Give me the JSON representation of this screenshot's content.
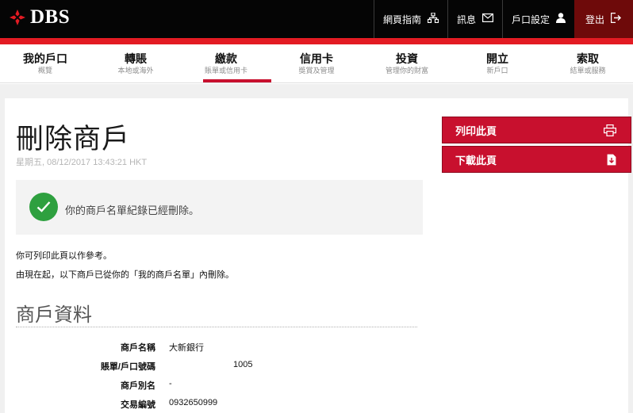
{
  "brand": {
    "name": "DBS"
  },
  "toplinks": [
    {
      "label": "網頁指南",
      "icon": "sitemap-icon"
    },
    {
      "label": "訊息",
      "icon": "envelope-icon"
    },
    {
      "label": "戶口設定",
      "icon": "user-icon"
    },
    {
      "label": "登出",
      "icon": "logout-icon"
    }
  ],
  "nav": [
    {
      "main": "我的戶口",
      "sub": "概覽"
    },
    {
      "main": "轉賬",
      "sub": "本地或海外"
    },
    {
      "main": "繳款",
      "sub": "賬單或信用卡"
    },
    {
      "main": "信用卡",
      "sub": "獎賞及管理"
    },
    {
      "main": "投資",
      "sub": "管理你的財富"
    },
    {
      "main": "開立",
      "sub": "新戶口"
    },
    {
      "main": "索取",
      "sub": "結單或服務"
    }
  ],
  "page": {
    "title": "刪除商戶",
    "timestamp": "星期五, 08/12/2017 13:43:21 HKT",
    "success_message": "你的商戶名單紀錄已經刪除。",
    "note1": "你可列印此頁以作參考。",
    "note2": "由現在起，以下商戶已從你的「我的商戶名單」內刪除。",
    "section_title": "商戶資料"
  },
  "details": [
    {
      "label": "商戶名稱",
      "value": "大新銀行"
    },
    {
      "label": "賬單/戶口號碼",
      "value": "1005"
    },
    {
      "label": "商戶別名",
      "value": "-"
    },
    {
      "label": "交易編號",
      "value": "0932650999"
    }
  ],
  "actions": {
    "print_label": "列印此頁",
    "download_label": "下載此頁"
  },
  "colors": {
    "brand_red": "#e31b23",
    "button_red": "#c8102e",
    "success_green": "#2ea03f"
  }
}
